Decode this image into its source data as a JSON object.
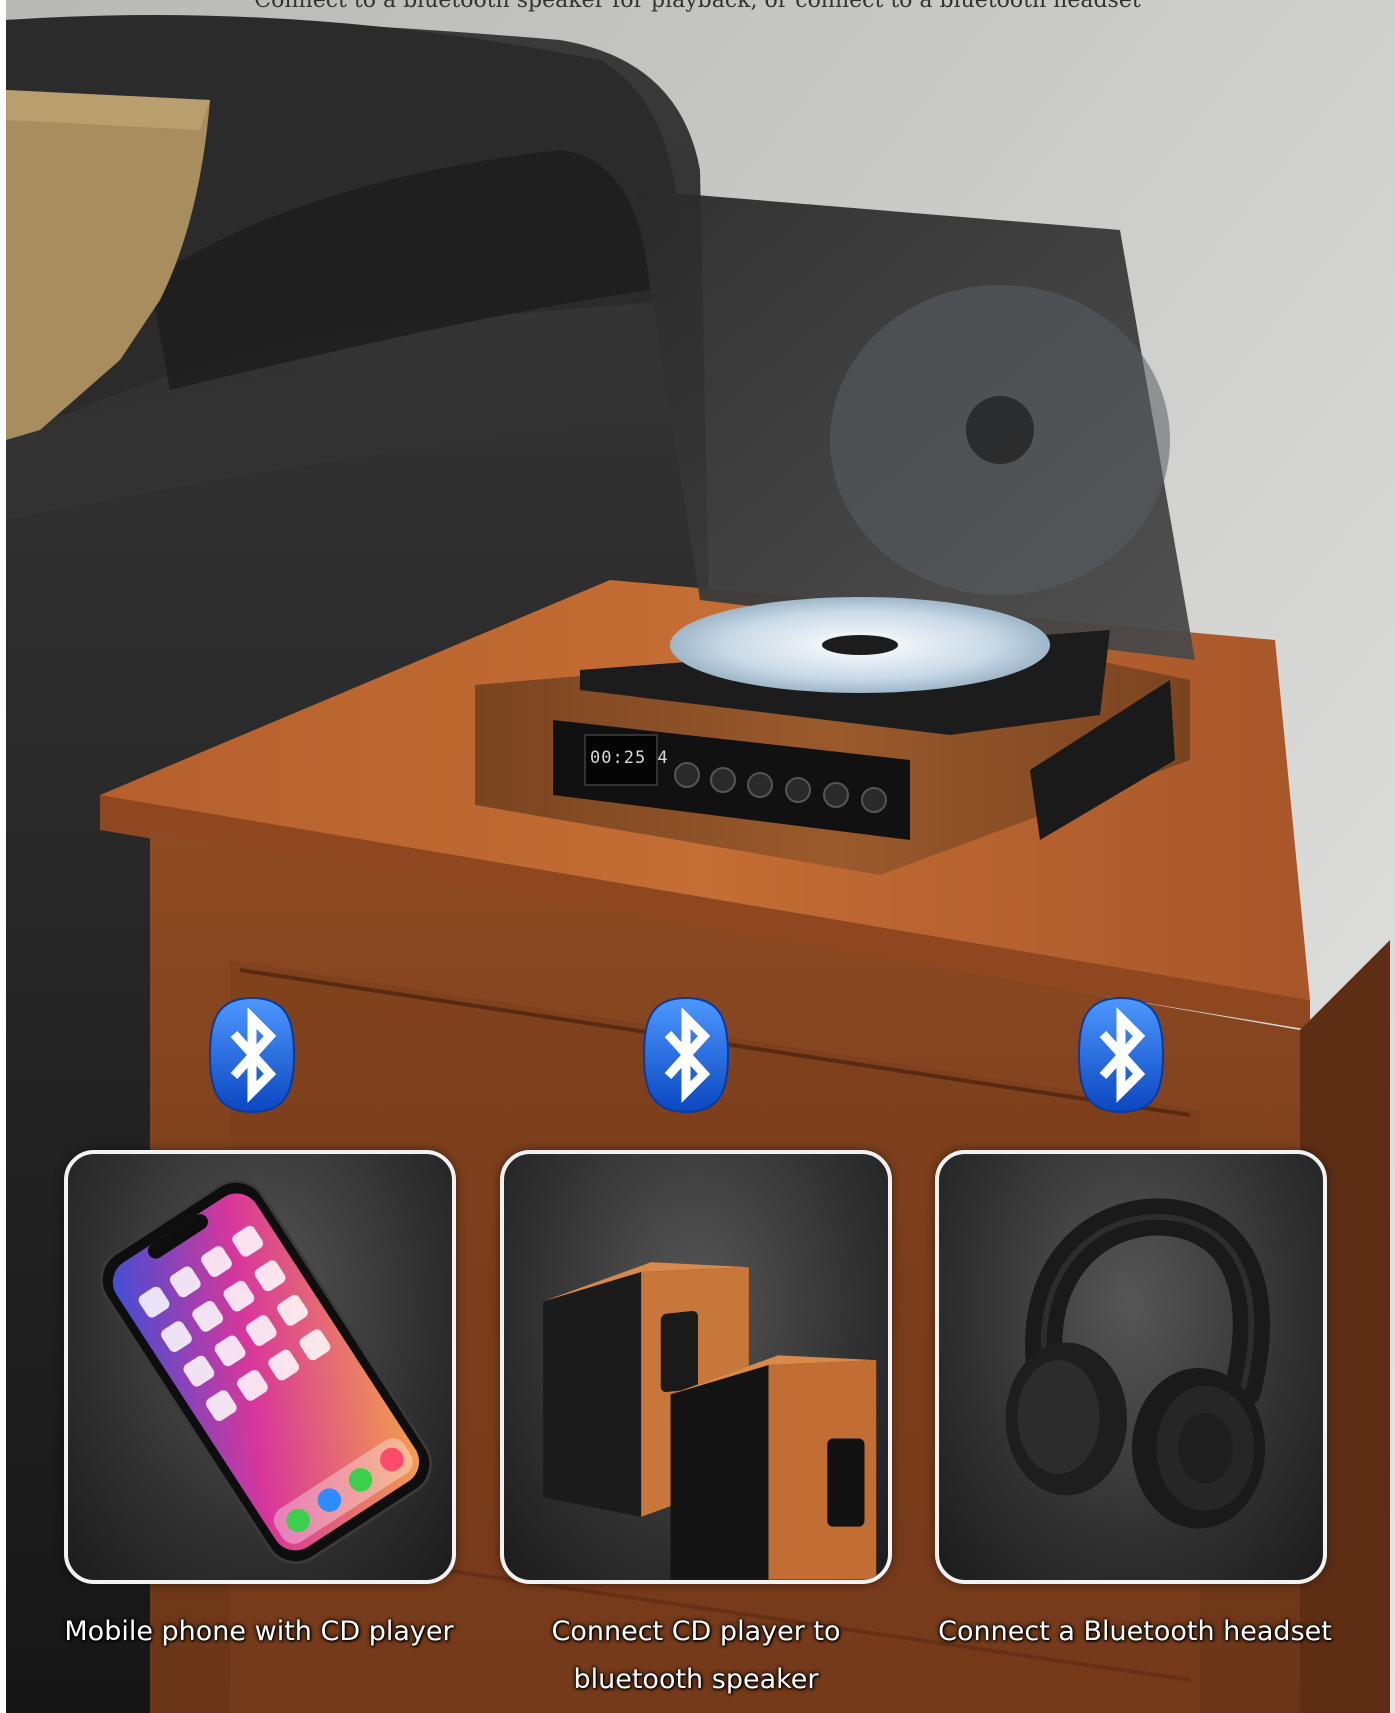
{
  "header": {
    "caption": "Connect to a bluetooth speaker for playback, or connect to a bluetooth headset"
  },
  "player": {
    "display_time": "00:25 4"
  },
  "features": [
    {
      "icon": "bluetooth-icon",
      "image": "smartphone",
      "caption_lines": [
        "Mobile phone with CD player"
      ]
    },
    {
      "icon": "bluetooth-icon",
      "image": "bookshelf-speakers",
      "caption_lines": [
        "Connect CD player to",
        "bluetooth speaker"
      ]
    },
    {
      "icon": "bluetooth-icon",
      "image": "headphones",
      "caption_lines": [
        "Connect a Bluetooth headset"
      ]
    }
  ],
  "colors": {
    "bluetooth_blue": "#1565e0",
    "wood": "#8a4a22",
    "card_border": "#f2f2f2"
  }
}
